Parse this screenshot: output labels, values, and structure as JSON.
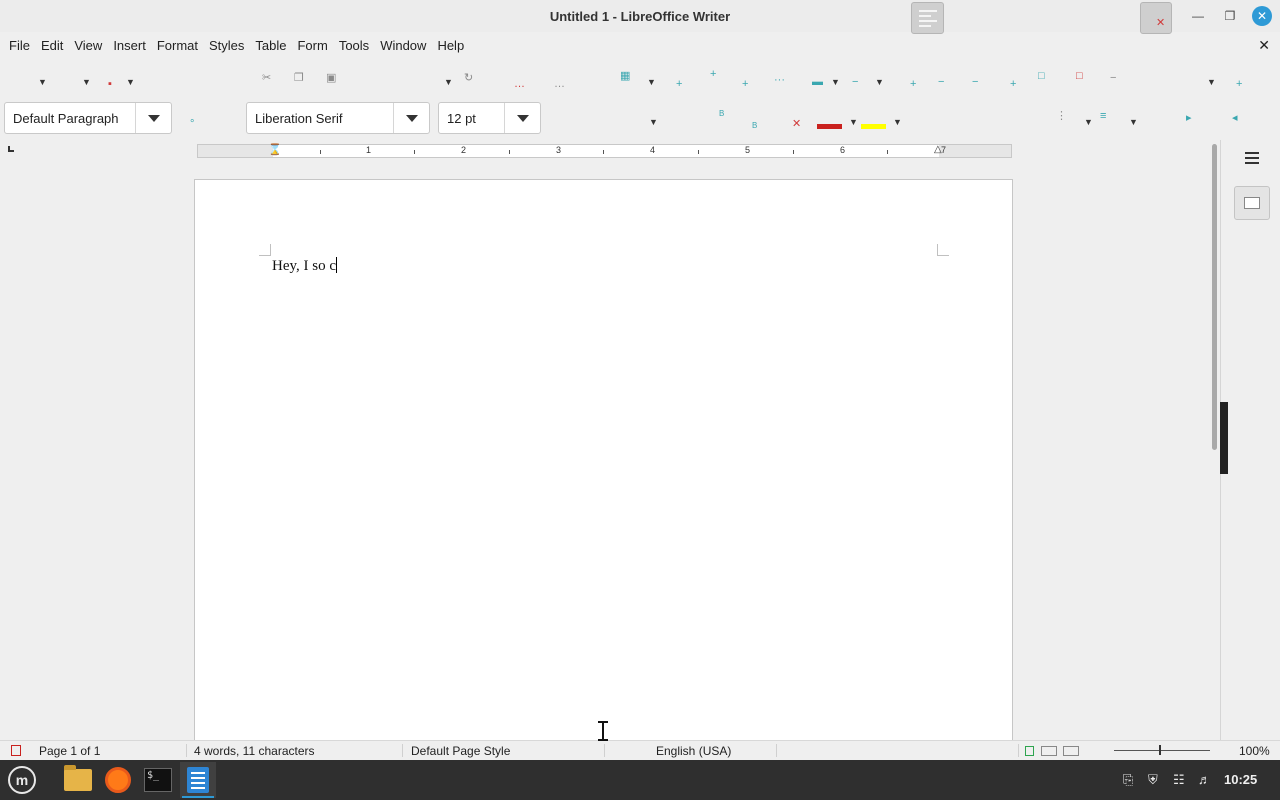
{
  "window": {
    "title": "Untitled 1 - LibreOffice Writer"
  },
  "menu": [
    "File",
    "Edit",
    "View",
    "Insert",
    "Format",
    "Styles",
    "Table",
    "Form",
    "Tools",
    "Window",
    "Help"
  ],
  "formatting": {
    "paragraph_style": "Default Paragraph",
    "font_name": "Liberation Serif",
    "font_size": "12 pt",
    "font_color": "#c9211e",
    "highlight_color": "#ffff00"
  },
  "ruler": {
    "numbers": [
      "1",
      "2",
      "3",
      "4",
      "5",
      "6",
      "7"
    ]
  },
  "document": {
    "text": "Hey, I so c"
  },
  "status": {
    "page": "Page 1 of 1",
    "words": "4 words, 11 characters",
    "page_style": "Default Page Style",
    "language": "English (USA)",
    "zoom": "100%"
  },
  "taskbar": {
    "apps": [
      "menu-icon",
      "files-icon",
      "firefox-icon",
      "terminal-icon",
      "writer-icon"
    ],
    "terminal_glyph": "$_",
    "mint_glyph": "m",
    "clock": "10:25"
  },
  "accent_color": "#2e9ad6"
}
